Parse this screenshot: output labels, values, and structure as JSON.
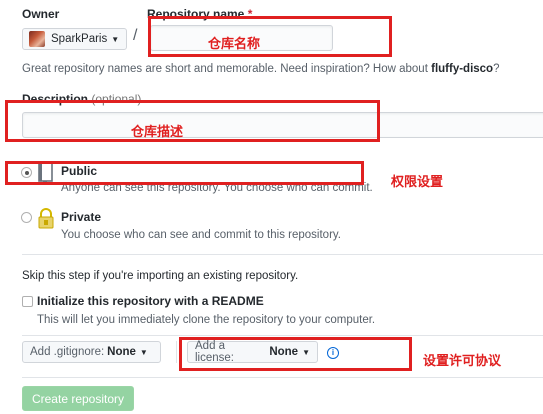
{
  "owner": {
    "label": "Owner",
    "value": "SparkParis"
  },
  "repo_name": {
    "label": "Repository name",
    "required_mark": "*",
    "annotation": "仓库名称"
  },
  "hint": {
    "text": "Great repository names are short and memorable. Need inspiration? How about ",
    "suggestion": "fluffy-disco",
    "end": "?"
  },
  "description": {
    "label": "Description",
    "optional": "(optional)",
    "annotation": "仓库描述"
  },
  "visibility": {
    "public": {
      "label": "Public",
      "desc": "Anyone can see this repository. You choose who can commit."
    },
    "private": {
      "label": "Private",
      "desc": "You choose who can see and commit to this repository."
    },
    "annotation": "权限设置"
  },
  "skip_text": "Skip this step if you're importing an existing repository.",
  "init_readme": {
    "label": "Initialize this repository with a README",
    "desc": "This will let you immediately clone the repository to your computer."
  },
  "gitignore": {
    "label": "Add .gitignore:",
    "value": "None"
  },
  "license": {
    "label": "Add a license:",
    "value": "None",
    "annotation": "设置许可协议"
  },
  "create_button": "Create repository",
  "colors": {
    "annotation_red": "#e02020",
    "create_green": "#94d3a2",
    "link_blue": "#0366d6"
  }
}
